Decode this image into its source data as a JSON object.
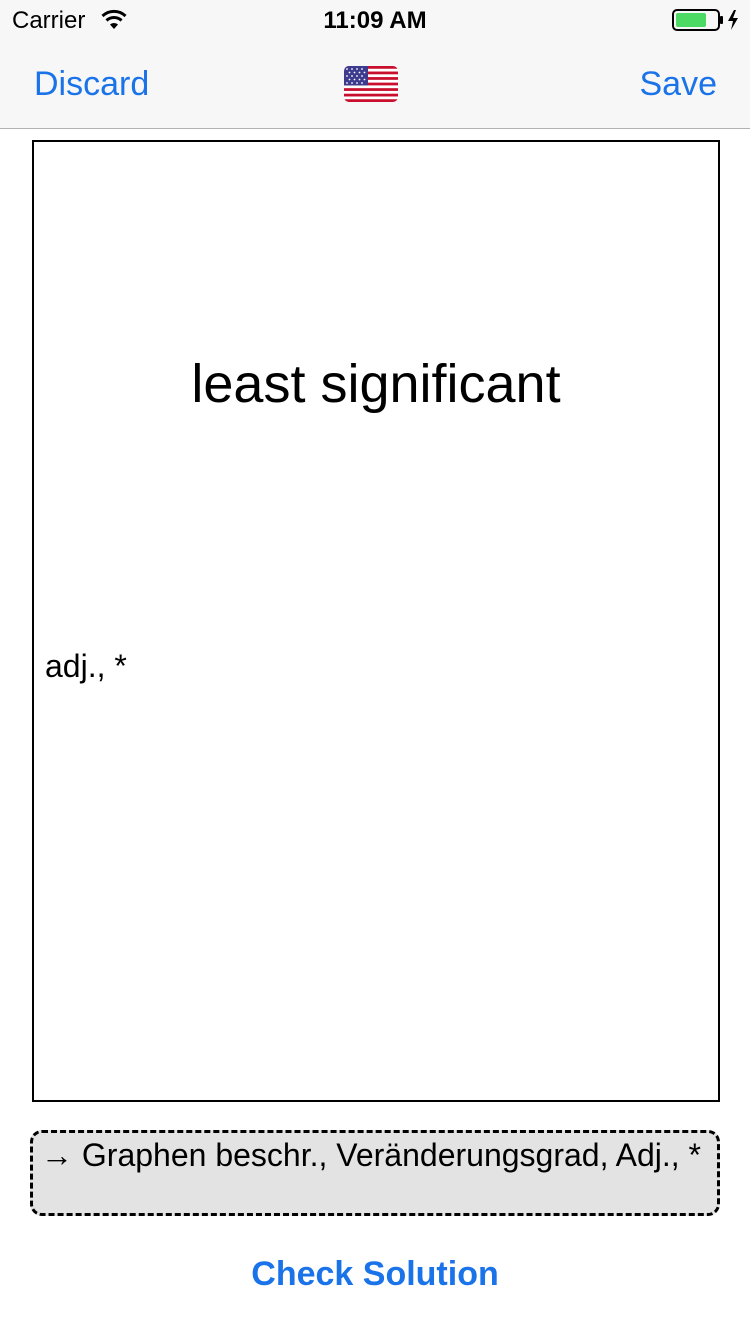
{
  "status_bar": {
    "carrier": "Carrier",
    "time": "11:09 AM",
    "wifi_icon": "wifi-icon",
    "battery_icon": "battery-charging-icon",
    "battery_fill": 0.75,
    "battery_color": "#4cd964"
  },
  "nav_bar": {
    "discard_label": "Discard",
    "save_label": "Save",
    "flag_icon": "us-flag-icon"
  },
  "card": {
    "term": "least significant",
    "meta": "adj., *"
  },
  "solution": {
    "text": "→ Graphen beschr., Veränderungsgrad, Adj., *"
  },
  "actions": {
    "check_label": "Check Solution"
  },
  "colors": {
    "accent": "#1a73e8",
    "solution_bg": "#e3e3e3",
    "bar_bg": "#f7f7f7"
  }
}
